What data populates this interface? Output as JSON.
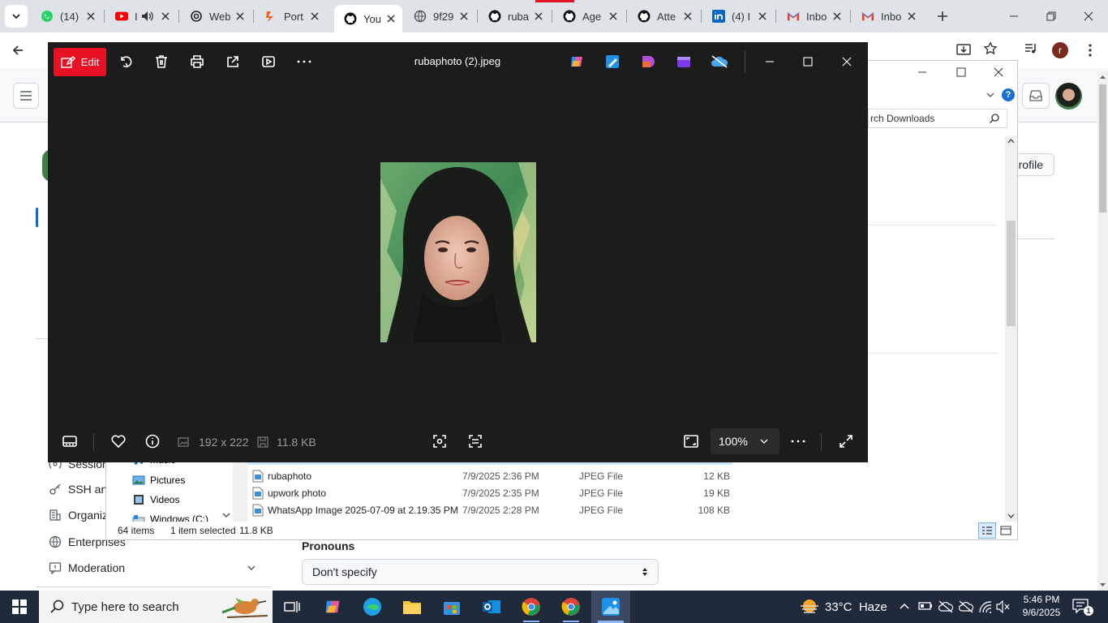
{
  "browser": {
    "tabs": [
      {
        "title": "(14)",
        "icon": "whatsapp-icon",
        "color": "#25d366"
      },
      {
        "title": "I",
        "icon": "youtube-icon",
        "color": "#ff0000"
      },
      {
        "title": "Web",
        "icon": "openai-icon",
        "color": "#222222"
      },
      {
        "title": "Port",
        "icon": "portfolio-icon",
        "color": "#f26522"
      },
      {
        "title": "You",
        "icon": "github-icon",
        "color": "#111111"
      },
      {
        "title": "9f29",
        "icon": "globe-icon",
        "color": "#555555"
      },
      {
        "title": "ruba",
        "icon": "github-icon",
        "color": "#111111"
      },
      {
        "title": "Age",
        "icon": "github-icon",
        "color": "#111111"
      },
      {
        "title": "Atte",
        "icon": "github-icon",
        "color": "#111111"
      },
      {
        "title": "(4) I",
        "icon": "linkedin-icon",
        "color": "#0a66c2"
      },
      {
        "title": "Inbo",
        "icon": "gmail-icon",
        "color": "#ea4335"
      },
      {
        "title": "Inbo",
        "icon": "gmail-icon",
        "color": "#ea4335"
      }
    ],
    "profile_initial": "r"
  },
  "github": {
    "profile_button": "profile",
    "sidebar": {
      "sessions": "Sessions",
      "ssh": "SSH and",
      "organizations": "Organiz",
      "enterprises": "Enterprises",
      "moderation": "Moderation"
    },
    "pronouns_label": "Pronouns",
    "pronouns_value": "Don't specify"
  },
  "explorer": {
    "search_placeholder": "rch Downloads",
    "nav_items": [
      "Music",
      "Pictures",
      "Videos",
      "Windows (C:)"
    ],
    "files": [
      {
        "name": "rubaphoto",
        "date": "7/9/2025 2:36 PM",
        "type": "JPEG File",
        "size": "12 KB"
      },
      {
        "name": "upwork photo",
        "date": "7/9/2025 2:35 PM",
        "type": "JPEG File",
        "size": "19 KB"
      },
      {
        "name": "WhatsApp Image 2025-07-09 at 2.19.35 PM",
        "date": "7/9/2025 2:28 PM",
        "type": "JPEG File",
        "size": "108 KB"
      }
    ],
    "status_items": "64 items",
    "status_selected": "1 item selected",
    "status_size": "11.8 KB"
  },
  "viewer": {
    "edit_label": "Edit",
    "title": "rubaphoto (2).jpeg",
    "dimensions": "192 x 222",
    "file_size": "11.8 KB",
    "zoom": "100%",
    "accent": "#e81123"
  },
  "taskbar": {
    "search_placeholder": "Type here to search",
    "weather": "33°C  Haze",
    "time": "5:46 PM",
    "date": "9/6/2025",
    "notification_count": "1"
  }
}
